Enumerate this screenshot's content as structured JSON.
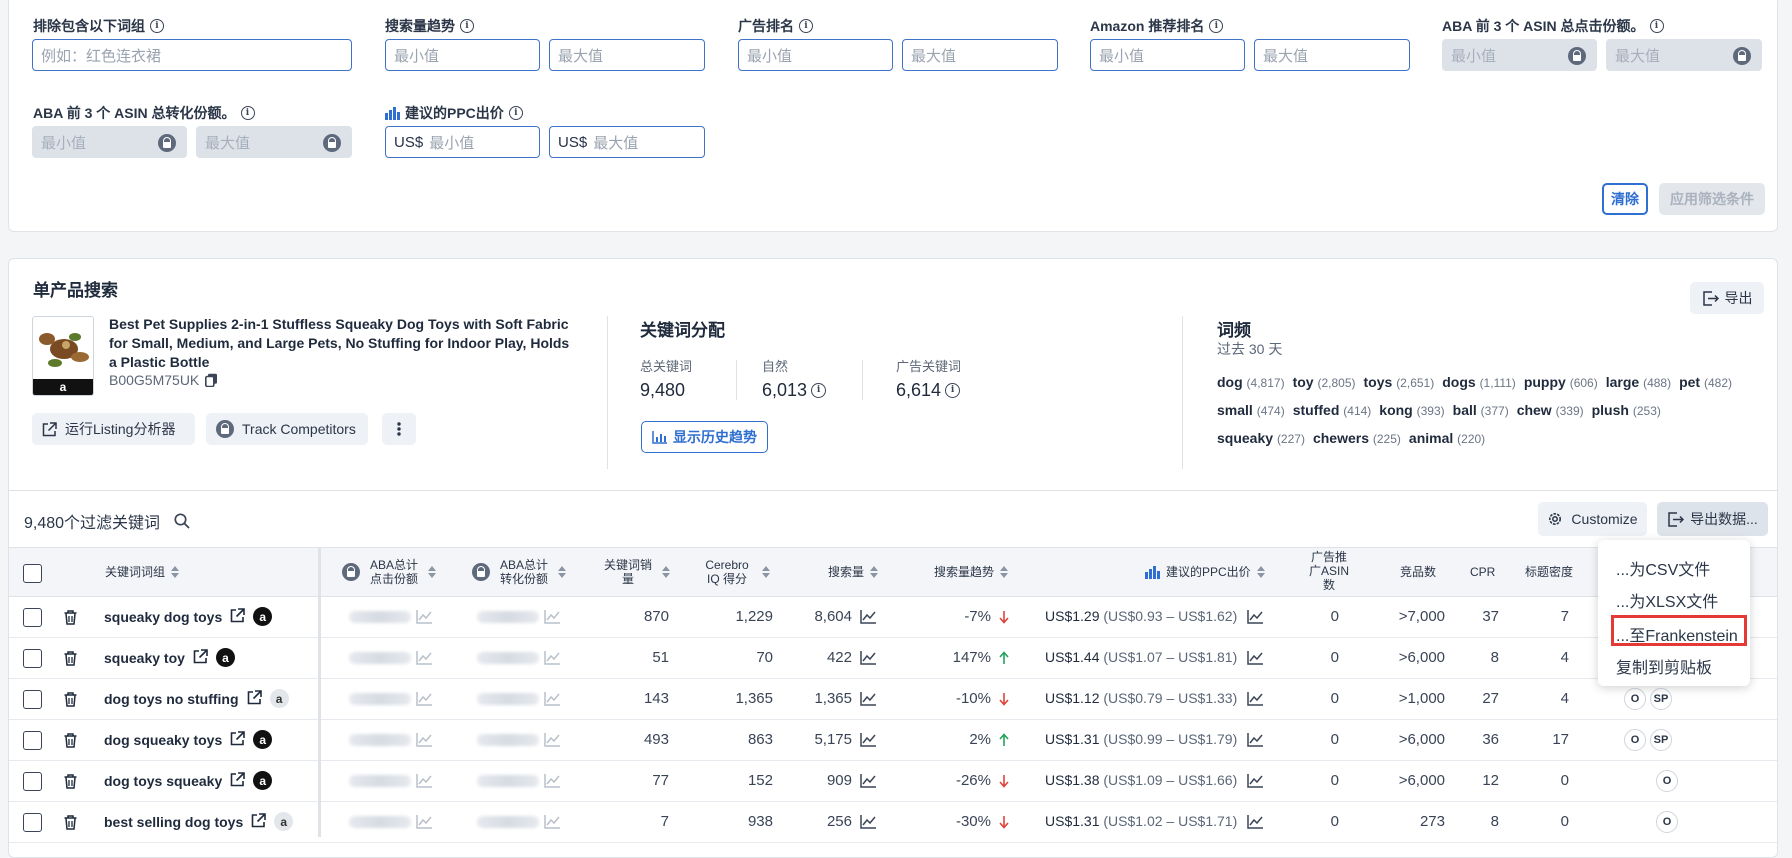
{
  "filters": {
    "exclude_words": {
      "label": "排除包含以下词组",
      "placeholder": "例如：红色连衣裙"
    },
    "search_trend": {
      "label": "搜索量趋势",
      "min": "最小值",
      "max": "最大值"
    },
    "ad_rank": {
      "label": "广告排名",
      "min": "最小值",
      "max": "最大值"
    },
    "amazon_rec_rank": {
      "label": "Amazon 推荐排名",
      "min": "最小值",
      "max": "最大值"
    },
    "aba_click_share": {
      "label": "ABA 前 3 个 ASIN 总点击份额。",
      "min": "最小值",
      "max": "最大值"
    },
    "aba_conv_share": {
      "label": "ABA 前 3 个 ASIN 总转化份额。",
      "min": "最小值",
      "max": "最大值"
    },
    "ppc_bid": {
      "label": "建议的PPC出价",
      "currency": "US$",
      "min": "最小值",
      "max": "最大值"
    },
    "clear_label": "清除",
    "apply_label": "应用筛选条件"
  },
  "product": {
    "section_title": "单产品搜索",
    "export_label": "导出",
    "title": "Best Pet Supplies 2-in-1 Stuffless Squeaky Dog Toys with Soft Fabric for Small, Medium, and Large Pets, No Stuffing for Indoor Play, Holds a Plastic Bottle",
    "asin": "B00G5M75UK",
    "thumb_badge": "a",
    "run_listing_label": "运行Listing分析器",
    "track_label": "Track Competitors"
  },
  "keyword_dist": {
    "title": "关键词分配",
    "total_label": "总关键词",
    "total_value": "9,480",
    "organic_label": "自然",
    "organic_value": "6,013",
    "sponsored_label": "广告关键词",
    "sponsored_value": "6,614",
    "history_label": "显示历史趋势"
  },
  "word_freq": {
    "title": "词频",
    "subtitle": "过去 30 天",
    "words": [
      {
        "w": "dog",
        "c": "(4,817)"
      },
      {
        "w": "toy",
        "c": "(2,805)"
      },
      {
        "w": "toys",
        "c": "(2,651)"
      },
      {
        "w": "dogs",
        "c": "(1,111)"
      },
      {
        "w": "puppy",
        "c": "(606)"
      },
      {
        "w": "large",
        "c": "(488)"
      },
      {
        "w": "pet",
        "c": "(482)"
      },
      {
        "w": "small",
        "c": "(474)"
      },
      {
        "w": "stuffed",
        "c": "(414)"
      },
      {
        "w": "kong",
        "c": "(393)"
      },
      {
        "w": "ball",
        "c": "(377)"
      },
      {
        "w": "chew",
        "c": "(339)"
      },
      {
        "w": "plush",
        "c": "(253)"
      },
      {
        "w": "squeaky",
        "c": "(227)"
      },
      {
        "w": "chewers",
        "c": "(225)"
      },
      {
        "w": "animal",
        "c": "(220)"
      }
    ]
  },
  "table_bar": {
    "count_label": "9,480个过滤关键词",
    "customize_label": "Customize",
    "export_data_label": "导出数据..."
  },
  "columns": {
    "keyword": "关键词词组",
    "aba_click": "ABA总计点击份额",
    "aba_conv": "ABA总计转化份额",
    "kw_sales": "关键词销量",
    "cerebro": "Cerebro IQ 得分",
    "search_vol": "搜索量",
    "search_trend": "搜索量趋势",
    "ppc": "建议的PPC出价",
    "ad_asin": "广告推广ASIN数",
    "competitors": "竞品数",
    "cpr": "CPR",
    "title_density": "标题密度"
  },
  "rows": [
    {
      "kw": "squeaky dog toys",
      "badge": "dark",
      "sales": "870",
      "iq": "1,229",
      "vol": "8,604",
      "trend": "-7%",
      "dir": "down",
      "ppc": "US$1.29",
      "range": "(US$0.93 – US$1.62)",
      "ad": "0",
      "comp": ">7,000",
      "cpr": "37",
      "td": "7",
      "chips": []
    },
    {
      "kw": "squeaky toy",
      "badge": "dark",
      "sales": "51",
      "iq": "70",
      "vol": "422",
      "trend": "147%",
      "dir": "up",
      "ppc": "US$1.44",
      "range": "(US$1.07 – US$1.81)",
      "ad": "0",
      "comp": ">6,000",
      "cpr": "8",
      "td": "4",
      "chips": []
    },
    {
      "kw": "dog toys no stuffing",
      "badge": "light",
      "sales": "143",
      "iq": "1,365",
      "vol": "1,365",
      "trend": "-10%",
      "dir": "down",
      "ppc": "US$1.12",
      "range": "(US$0.79 – US$1.33)",
      "ad": "0",
      "comp": ">1,000",
      "cpr": "27",
      "td": "4",
      "chips": [
        "O",
        "SP"
      ]
    },
    {
      "kw": "dog squeaky toys",
      "badge": "dark",
      "sales": "493",
      "iq": "863",
      "vol": "5,175",
      "trend": "2%",
      "dir": "up",
      "ppc": "US$1.31",
      "range": "(US$0.99 – US$1.79)",
      "ad": "0",
      "comp": ">6,000",
      "cpr": "36",
      "td": "17",
      "chips": [
        "O",
        "SP"
      ]
    },
    {
      "kw": "dog toys squeaky",
      "badge": "dark",
      "sales": "77",
      "iq": "152",
      "vol": "909",
      "trend": "-26%",
      "dir": "down",
      "ppc": "US$1.38",
      "range": "(US$1.09 – US$1.66)",
      "ad": "0",
      "comp": ">6,000",
      "cpr": "12",
      "td": "0",
      "chips": [
        "O"
      ]
    },
    {
      "kw": "best selling dog toys",
      "badge": "light",
      "sales": "7",
      "iq": "938",
      "vol": "256",
      "trend": "-30%",
      "dir": "down",
      "ppc": "US$1.31",
      "range": "(US$1.02 – US$1.71)",
      "ad": "0",
      "comp": "273",
      "cpr": "8",
      "td": "0",
      "chips": [
        "O"
      ]
    }
  ],
  "export_menu": {
    "csv": "...为CSV文件",
    "xlsx": "...为XLSX文件",
    "frankenstein": "...至Frankenstein",
    "clipboard": "复制到剪贴板"
  },
  "colors": {
    "accent": "#2f6fd1",
    "highlight": "#e53935",
    "up": "#25a35a",
    "down": "#e0453b"
  }
}
